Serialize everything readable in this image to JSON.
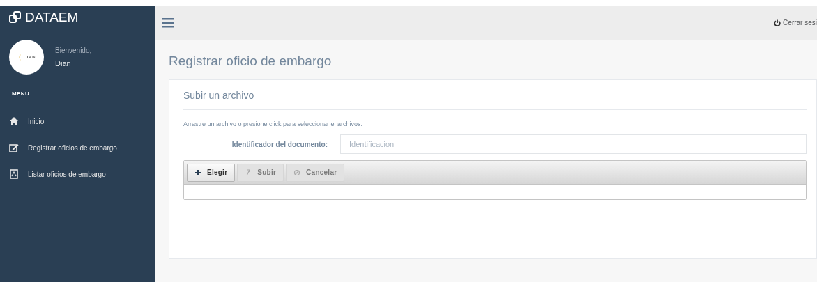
{
  "sidebar": {
    "brand": "DATAEM",
    "welcome": "Bienvenido,",
    "user": "Dian",
    "avatar_text": "DIAN",
    "menu_title": "MENU",
    "items": [
      {
        "label": "Inicio",
        "selected": false
      },
      {
        "label": "Registrar oficios de embargo",
        "selected": false
      },
      {
        "label": "Listar oficios de embargo",
        "selected": false
      }
    ]
  },
  "topbar": {
    "logout": "Cerrar sesi"
  },
  "page": {
    "title": "Registrar oficio de embargo",
    "panel_title": "Subir un archivo",
    "hint": "Arrastre un archivo o presione click para seleccionar el archivos.",
    "field": {
      "label": "Identificador del documento:",
      "placeholder": "Identificacion"
    },
    "buttons": [
      {
        "label": "Elegir",
        "disabled": false
      },
      {
        "label": "Subir",
        "disabled": true
      },
      {
        "label": "Cancelar",
        "disabled": true
      }
    ]
  }
}
